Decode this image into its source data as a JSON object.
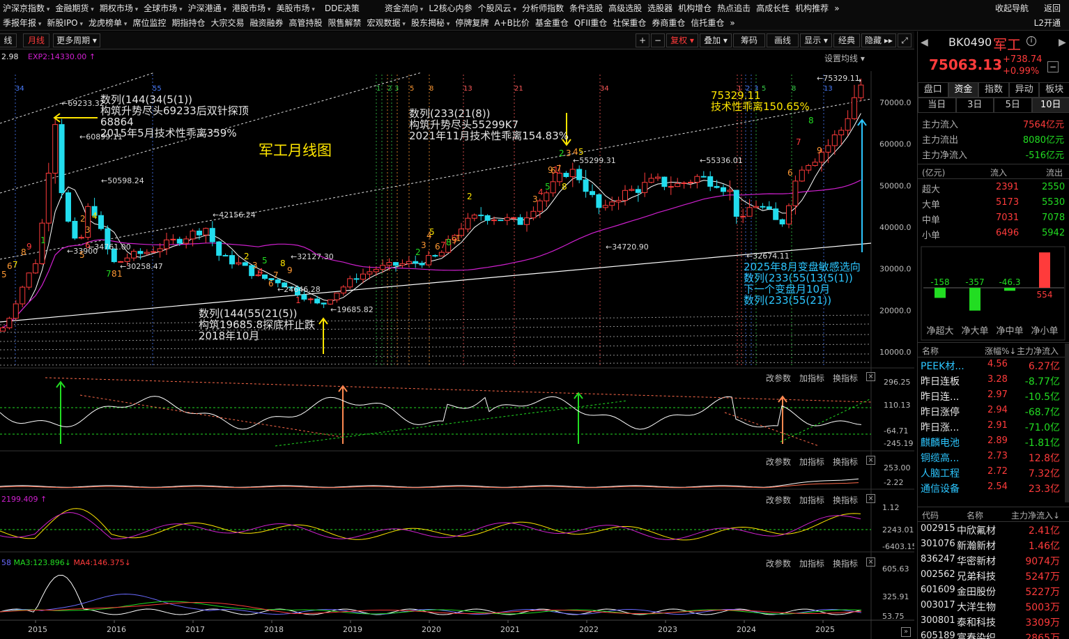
{
  "menu": {
    "row1": [
      "沪深京指数",
      "金融期货",
      "期权市场",
      "全球市场",
      "沪深港通",
      "港股市场",
      "美股市场",
      "DDE决策",
      "资金流向",
      "L2核心内参",
      "个股风云",
      "分析师指数",
      "条件选股",
      "高级选股",
      "选股器",
      "机构增仓",
      "热点追击",
      "高成长性",
      "机构推荐"
    ],
    "row1_dropdown": [
      true,
      true,
      true,
      true,
      true,
      true,
      true,
      false,
      true,
      false,
      true,
      false,
      false,
      false,
      false,
      false,
      false,
      false,
      false
    ],
    "row2": [
      "季报年报",
      "新股IPO",
      "龙虎榜单",
      "席位监控",
      "期指持仓",
      "大宗交易",
      "融资融券",
      "高管持股",
      "限售解禁",
      "宏观数据",
      "股东揭秘",
      "停牌复牌",
      "A+B比价",
      "基金重仓",
      "QFII重仓",
      "社保重仓",
      "券商重仓",
      "信托重仓"
    ],
    "row2_dropdown": [
      true,
      true,
      true,
      false,
      false,
      false,
      false,
      false,
      false,
      true,
      true,
      false,
      false,
      false,
      false,
      false,
      false,
      false
    ],
    "row1_more": "»",
    "row2_more": "»",
    "right1": [
      "收起导航",
      "返回"
    ],
    "right2": [
      "L2开通"
    ]
  },
  "toolbar": {
    "left": [
      "线",
      "月线",
      "更多周期"
    ],
    "right": [
      "+",
      "−",
      "复权",
      "叠加",
      "筹码",
      "画线",
      "显示",
      "经典",
      "隐藏",
      "⤢"
    ]
  },
  "chart": {
    "title_note": "军工月线图",
    "legend_top": {
      "left": "2.98",
      "exp2": "EXP2:14330.00"
    },
    "y_axis": [
      "70000.0",
      "60000.0",
      "50000.0",
      "40000.0",
      "30000.0",
      "20000.0",
      "10000.0"
    ],
    "x_axis": [
      "2015",
      "2016",
      "2017",
      "2018",
      "2019",
      "2020",
      "2021",
      "2022",
      "2023",
      "2024",
      "2025"
    ],
    "set_ma": "设置均线",
    "vertical_labels": [
      {
        "t": "34",
        "c": "#4a7dff"
      },
      {
        "t": "55",
        "c": "#4a7dff"
      },
      {
        "t": "1",
        "c": "#39d04a"
      },
      {
        "t": "2",
        "c": "#39d04a"
      },
      {
        "t": "3",
        "c": "#39d04a"
      },
      {
        "t": "5",
        "c": "#ff9933"
      },
      {
        "t": "8",
        "c": "#ff9933"
      },
      {
        "t": "13",
        "c": "#ff5a5a"
      },
      {
        "t": "21",
        "c": "#ff5a5a"
      },
      {
        "t": "34",
        "c": "#ff5a5a"
      },
      {
        "t": "1",
        "c": "#ff5a5a"
      },
      {
        "t": "2",
        "c": "#4a7dff"
      },
      {
        "t": "3",
        "c": "#4a7dff"
      },
      {
        "t": "5",
        "c": "#39d04a"
      },
      {
        "t": "8",
        "c": "#39d04a"
      },
      {
        "t": "13",
        "c": "#4a7dff"
      }
    ],
    "price_labels": [
      "69233.32",
      "60899.11",
      "50598.24",
      "33900",
      "34761.00",
      "30258.47",
      "42156.24",
      "32127.30",
      "24646.28",
      "19685.82",
      "55299.31",
      "34720.90",
      "55336.01",
      "32674.11",
      "75329.11"
    ],
    "annotations": {
      "a1": [
        "数列(144(34(5(1))",
        "构筑升势尽头69233后双针探顶",
        "68864",
        "2015年5月技术性乖离359%"
      ],
      "a2": [
        "数列(233(21(8))",
        "构筑升势尽头55299K7",
        "2021年11月技术性乖离154.83%"
      ],
      "a3": [
        "75329.11",
        "技术性乖离150.65%"
      ],
      "a4": [
        "数列(144(55(21(5))",
        "构筑19685.8探底杆止跌",
        "2018年10月"
      ],
      "a5": [
        "2025年8月变盘敏感选向",
        "数列(233(55(13(5(1))",
        "下一个变盘月10月",
        "数列(233(55(21))"
      ]
    },
    "counts": [
      "5",
      "6",
      "7",
      "8",
      "9",
      "1",
      "2",
      "3",
      "4",
      "5",
      "6",
      "7",
      "8",
      "1",
      "2",
      "3",
      "4",
      "5",
      "6",
      "7",
      "8",
      "9",
      "1",
      "2",
      "3",
      "4",
      "5",
      "6",
      "7",
      "8",
      "9",
      "1",
      "2",
      "3",
      "4",
      "5",
      "6",
      "7",
      "8",
      "9",
      "1",
      "2",
      "3",
      "4",
      "5",
      "6",
      "7",
      "8",
      "9"
    ]
  },
  "indicators": {
    "controls": [
      "改参数",
      "加指标",
      "换指标"
    ],
    "p1": {
      "axis": [
        "296.25",
        "110.13",
        "-64.71",
        "-245.19"
      ]
    },
    "p2": {
      "axis": [
        "253.00",
        "-2.22"
      ]
    },
    "p3": {
      "legend": "2199.409",
      "axis": [
        "1.12",
        "2243.01",
        "-6403.15"
      ]
    },
    "p4": {
      "legend_a": "58",
      "legend_ma3": "MA3:123.896",
      "legend_ma4": "MA4:146.375",
      "axis": [
        "605.63",
        "325.91",
        "53.75"
      ]
    }
  },
  "quote": {
    "code": "BK0490",
    "name": "军工",
    "price": "75063.13",
    "change": "+738.74",
    "pct": "+0.99%",
    "tabs1": [
      "盘口",
      "资金",
      "指数",
      "异动",
      "板块"
    ],
    "tabs1_active": 1,
    "tabs2": [
      "当日",
      "3日",
      "5日",
      "10日"
    ],
    "tabs2_active": 3,
    "flow": [
      {
        "label": "主力流入",
        "value": "7564亿元",
        "color": "#ff3b3b"
      },
      {
        "label": "主力流出",
        "value": "8080亿元",
        "color": "#22dd22"
      },
      {
        "label": "主力净流入",
        "value": "-516亿元",
        "color": "#22dd22"
      }
    ],
    "flow_header": [
      "(亿元)",
      "流入",
      "流出"
    ],
    "flow_table": [
      {
        "label": "超大",
        "in": "2391",
        "out": "2550"
      },
      {
        "label": "大单",
        "in": "5173",
        "out": "5530"
      },
      {
        "label": "中单",
        "in": "7031",
        "out": "7078"
      },
      {
        "label": "小单",
        "in": "6496",
        "out": "5942"
      }
    ],
    "net_bars": [
      {
        "label": "净超大",
        "value": "-158",
        "num": -158
      },
      {
        "label": "净大单",
        "value": "-357",
        "num": -357
      },
      {
        "label": "净中单",
        "value": "-46.3",
        "num": -46.3
      },
      {
        "label": "净小单",
        "value": "554",
        "num": 554
      }
    ],
    "list1_header": [
      "名称",
      "涨幅%↓",
      "主力净流入"
    ],
    "list1": [
      {
        "name": "PEEK材...",
        "pct": "4.56",
        "net": "6.27亿",
        "nc": "#2cc6ff",
        "vc": "#ff3b3b"
      },
      {
        "name": "昨日连板",
        "pct": "3.28",
        "net": "-8.77亿",
        "nc": "#e6e6e6",
        "vc": "#22dd22"
      },
      {
        "name": "昨日连...",
        "pct": "2.97",
        "net": "-10.5亿",
        "nc": "#e6e6e6",
        "vc": "#22dd22"
      },
      {
        "name": "昨日涨停",
        "pct": "2.94",
        "net": "-68.7亿",
        "nc": "#e6e6e6",
        "vc": "#22dd22"
      },
      {
        "name": "昨日涨...",
        "pct": "2.91",
        "net": "-71.0亿",
        "nc": "#e6e6e6",
        "vc": "#22dd22"
      },
      {
        "name": "麒麟电池",
        "pct": "2.89",
        "net": "-1.81亿",
        "nc": "#2cc6ff",
        "vc": "#22dd22"
      },
      {
        "name": "铜缆高...",
        "pct": "2.73",
        "net": "12.8亿",
        "nc": "#2cc6ff",
        "vc": "#ff3b3b"
      },
      {
        "name": "人脑工程",
        "pct": "2.72",
        "net": "7.32亿",
        "nc": "#2cc6ff",
        "vc": "#ff3b3b"
      },
      {
        "name": "通信设备",
        "pct": "2.54",
        "net": "23.3亿",
        "nc": "#2cc6ff",
        "vc": "#ff3b3b"
      }
    ],
    "list2_header": [
      "代码",
      "名称",
      "主力净流入↓"
    ],
    "list2": [
      {
        "code": "002915",
        "name": "中欣氟材",
        "net": "2.41亿"
      },
      {
        "code": "301076",
        "name": "新瀚新材",
        "net": "1.46亿"
      },
      {
        "code": "836247",
        "name": "华密新材",
        "net": "9074万"
      },
      {
        "code": "002562",
        "name": "兄弟科技",
        "net": "5247万"
      },
      {
        "code": "601609",
        "name": "金田股份",
        "net": "5227万"
      },
      {
        "code": "003017",
        "name": "大洋生物",
        "net": "5003万"
      },
      {
        "code": "300801",
        "name": "泰和科技",
        "net": "3309万"
      },
      {
        "code": "605189",
        "name": "富春染织",
        "net": "2865万"
      }
    ]
  },
  "colors": {
    "up": "#ff3b3b",
    "down": "#22ddee",
    "ma": "#d020d0",
    "accent": "#ffe600"
  }
}
